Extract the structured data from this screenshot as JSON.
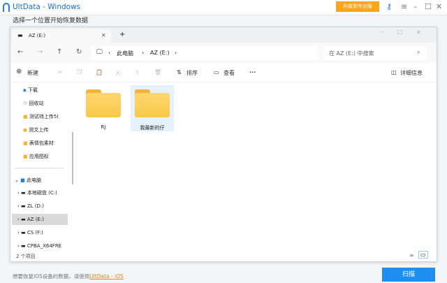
{
  "app": {
    "title": "UltData - Windows",
    "upgrade": "升级到专业版",
    "background_hint": "选择一个位置开始恢复数据"
  },
  "explorer": {
    "tab": "AZ (E:)",
    "new_tab": "+",
    "breadcrumb": [
      "此电脑",
      "AZ (E:)"
    ],
    "search_placeholder": "在 AZ (E:) 中搜索",
    "toolbar": {
      "new": "新建",
      "sort": "排序",
      "view": "查看",
      "more": "···",
      "details": "详细信息"
    },
    "quick_access": [
      {
        "label": "下载",
        "icon": "download-icon"
      },
      {
        "label": "回收站",
        "icon": "recycle-bin-icon"
      },
      {
        "label": "测试待上传5(",
        "icon": "folder-icon"
      },
      {
        "label": "测文上传",
        "icon": "emoji-folder-icon"
      },
      {
        "label": "表情包素材",
        "icon": "folder-icon"
      },
      {
        "label": "应用图标",
        "icon": "folder-icon"
      }
    ],
    "this_pc": "此电脑",
    "drives": [
      {
        "label": "本地磁盘 (C:)"
      },
      {
        "label": "ZL (D:)"
      },
      {
        "label": "AZ (E:)",
        "selected": true
      },
      {
        "label": "CS (F:)"
      },
      {
        "label": "CPBA_X64FRE"
      }
    ],
    "folders": [
      {
        "name": "RJ"
      },
      {
        "name": "我最新的仔",
        "selected": true
      }
    ],
    "status": "2 个项目"
  },
  "footer": {
    "text": "想要恢复iOS设备的数据，请使用",
    "link": "UltData - iOS"
  },
  "scan_button": "扫描",
  "colors": {
    "accent": "#1e8ff0",
    "upgrade": "#ffa41b"
  }
}
